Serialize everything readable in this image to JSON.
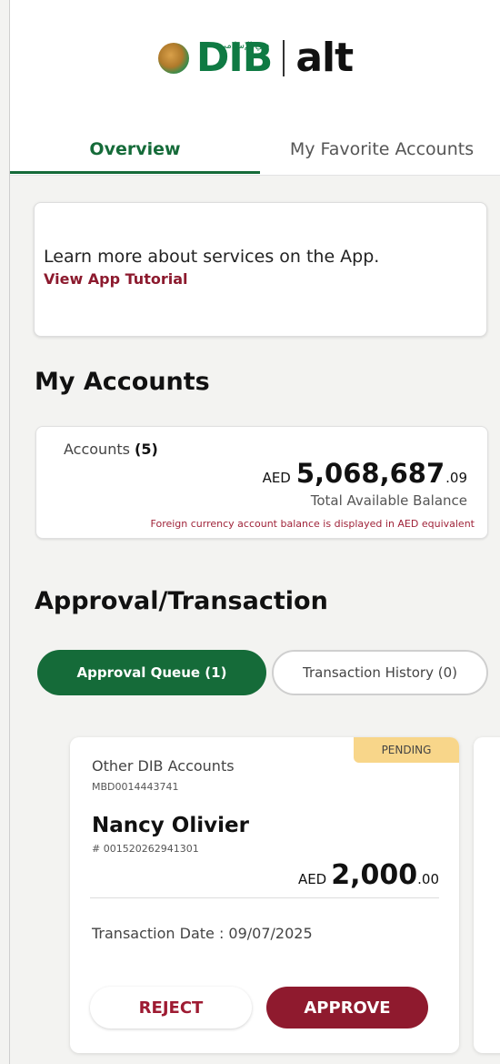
{
  "header": {
    "brand_arabic": "دبي الإسلامي",
    "brand_dib": "DIB",
    "brand_alt": "alt"
  },
  "tabs": [
    {
      "label": "Overview",
      "active": true
    },
    {
      "label": "My Favorite Accounts",
      "active": false
    }
  ],
  "tutorial": {
    "text": "Learn more about services on the App.",
    "link": "View App Tutorial"
  },
  "accounts": {
    "heading": "My Accounts",
    "label": "Accounts",
    "count": "(5)",
    "currency": "AED",
    "balance_int": "5,068,687",
    "balance_dec": ".09",
    "balance_label": "Total Available Balance",
    "note": "Foreign currency account balance is displayed in AED equivalent"
  },
  "approval": {
    "heading": "Approval/Transaction",
    "queue_tab": "Approval Queue (1)",
    "history_tab": "Transaction History (0)",
    "card": {
      "status": "PENDING",
      "type": "Other DIB Accounts",
      "account": "MBD0014443741",
      "name": "Nancy Olivier",
      "iban": "# 001520262941301",
      "currency": "AED",
      "amount_int": "2,000",
      "amount_dec": ".00",
      "date": "Transaction Date : 09/07/2025",
      "reject": "REJECT",
      "approve": "APPROVE"
    }
  },
  "colors": {
    "brand_green": "#156b39",
    "brand_maroon": "#8f1a2e",
    "pending_badge": "#f8d68a"
  }
}
